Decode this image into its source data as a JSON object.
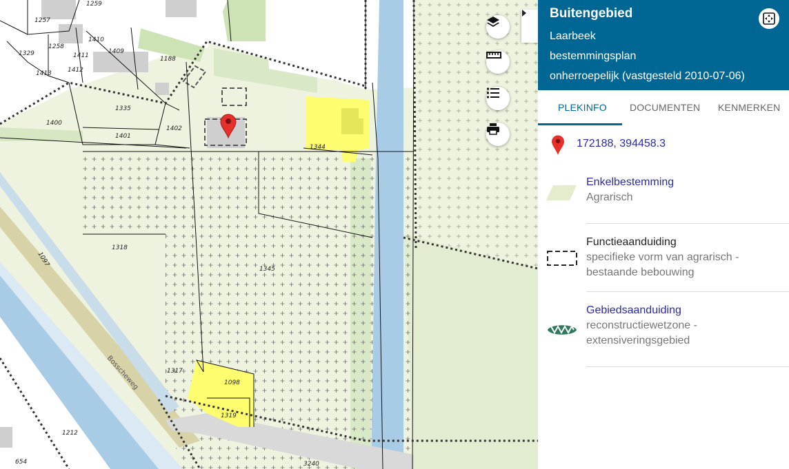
{
  "panel": {
    "title": "Buitengebied",
    "municipality": "Laarbeek",
    "plan_type": "bestemmingsplan",
    "status": "onherroepelijk (vastgesteld 2010-07-06)",
    "fullscreen_icon": "fullscreen-icon"
  },
  "tabs": [
    {
      "label": "PLEKINFO",
      "active": true
    },
    {
      "label": "DOCUMENTEN",
      "active": false
    },
    {
      "label": "KENMERKEN",
      "active": false
    }
  ],
  "location": {
    "coordinates": "172188, 394458.3",
    "icon": "location-pin-icon"
  },
  "legend": [
    {
      "heading": "Enkelbestemming",
      "lines": [
        "Agrarisch"
      ],
      "link": true,
      "symbol": "agricultural-zone-icon"
    },
    {
      "heading": "Functieaanduiding",
      "lines": [
        "specifieke vorm van agrarisch -",
        "bestaande bebouwing"
      ],
      "link": false,
      "symbol": "dashed-rectangle-icon"
    },
    {
      "heading": "Gebiedsaanduiding",
      "lines": [
        "reconstructiewetzone -",
        "extensiveringsgebied"
      ],
      "link": true,
      "symbol": "zigzag-band-icon"
    }
  ],
  "map": {
    "controls": [
      "layers-icon",
      "ruler-icon",
      "list-icon",
      "print-icon"
    ],
    "collapse_icon": "chevron-right-icon",
    "parcel_labels": [
      "1259",
      "1257",
      "1258",
      "1410",
      "1409",
      "1329",
      "1411",
      "1413",
      "1412",
      "1188",
      "1335",
      "1400",
      "1402",
      "1401",
      "1344",
      "1318",
      "1345",
      "1097",
      "1317",
      "1098",
      "1319",
      "1212",
      "654",
      "3240"
    ],
    "road_label": "Bosscheweg"
  },
  "colors": {
    "header": "#006694",
    "agrarisch": "#eef3df",
    "yellow_plot": "#fdfd6f",
    "water": "#a8cbe6",
    "green": "#cde3b5"
  }
}
